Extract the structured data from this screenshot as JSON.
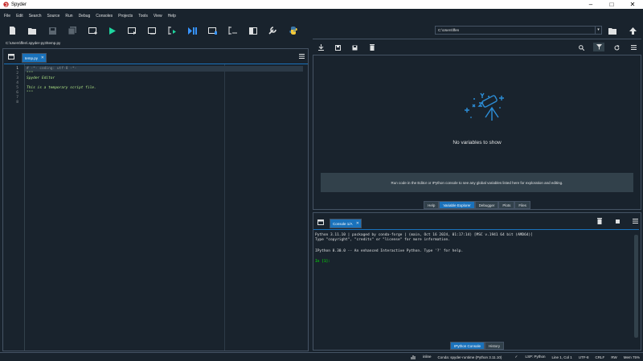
{
  "window": {
    "title": "Spyder"
  },
  "menu": [
    "File",
    "Edit",
    "Search",
    "Source",
    "Run",
    "Debug",
    "Consoles",
    "Projects",
    "Tools",
    "View",
    "Help"
  ],
  "toolbar": {
    "working_dir": "C:\\Users\\ffen"
  },
  "editor": {
    "path": "C:\\Users\\ffen\\.spyder-py3\\temp.py",
    "tab_label": "temp.py",
    "line_numbers": [
      "1",
      "2",
      "3",
      "4",
      "5",
      "6",
      "7",
      "8"
    ],
    "lines": [
      "# -*- coding: utf-8 -*-",
      "\"\"\"",
      "Spyder Editor",
      "",
      "This is a temporary script file.",
      "\"\"\""
    ]
  },
  "variable_explorer": {
    "empty_message": "No variables to show",
    "hint": "Run code in the Editor or IPython console to see any global variables listed here for exploration and editing.",
    "tabs": [
      "Help",
      "Variable Explorer",
      "Debugger",
      "Plots",
      "Files"
    ],
    "active_tab": "Variable Explorer"
  },
  "console": {
    "tab_label": "Console 1/A",
    "lines": [
      "Python 3.11.10 | packaged by conda-forge | (main, Oct 16 2024, 01:17:14) [MSC v.1941 64 bit (AMD64)]",
      "Type \"copyright\", \"credits\" or \"license\" for more information.",
      "",
      "IPython 8.30.0 -- An enhanced Interactive Python. Type '?' for help.",
      "",
      "In [1]:"
    ],
    "tabs": [
      "IPython Console",
      "History"
    ],
    "active_tab": "IPython Console"
  },
  "statusbar": {
    "inline": "inline",
    "conda": "Conda: spyder-runtime (Python 3.11.10)",
    "lsp": "LSP: Python",
    "cursor": "Line 1, Col 1",
    "encoding": "UTF-8",
    "eol": "CRLF",
    "permissions": "RW",
    "memory": "Mem 75%"
  },
  "colors": {
    "accent": "#1a72bb",
    "background": "#19232d",
    "border": "#455364",
    "comment": "#8d9497",
    "string": "#b0e686",
    "prompt": "#00ff00"
  }
}
